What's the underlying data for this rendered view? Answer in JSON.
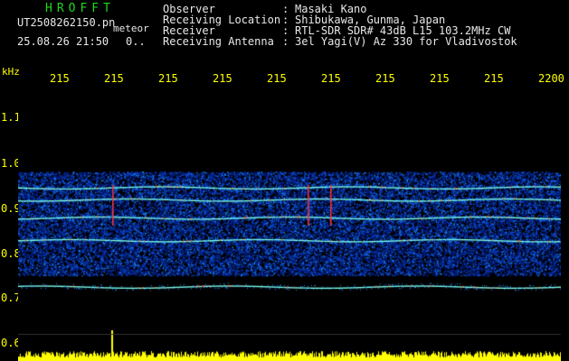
{
  "header": {
    "logo": "HROFFT",
    "file_name": "UT2508262150.pn",
    "meteor_label": "meteor",
    "datetime": "25.08.26 21:50",
    "count": "0.."
  },
  "info": [
    {
      "label": "Observer",
      "value": "Masaki Kano"
    },
    {
      "label": "Receiving Location",
      "value": "Shibukawa, Gunma, Japan"
    },
    {
      "label": "Receiver",
      "value": "RTL-SDR SDR# 43dB L15 103.2MHz CW"
    },
    {
      "label": "Receiving Antenna",
      "value": "3el Yagi(V) Az 330 for Vladivostok"
    }
  ],
  "separator": ":",
  "axis": {
    "y_unit": "kHz",
    "x_ticks": [
      "215",
      "215",
      "215",
      "215",
      "215",
      "215",
      "215",
      "215",
      "215",
      "2200"
    ],
    "y_ticks": [
      "1.1",
      "1.0",
      "0.9",
      "0.8",
      "0.7",
      "0.6"
    ]
  },
  "spectrogram": {
    "bands_khz": [
      0.985,
      0.958,
      0.918,
      0.868,
      0.765
    ],
    "noise_floor_khz": [
      0.79,
      1.02
    ],
    "colors": {
      "background": "#000000",
      "noise_low": "#001f8c",
      "noise_high": "#1c8cff",
      "band": "#7dffe6",
      "band_hot": "#ff5a28",
      "power_trace": "#ffff00"
    }
  }
}
